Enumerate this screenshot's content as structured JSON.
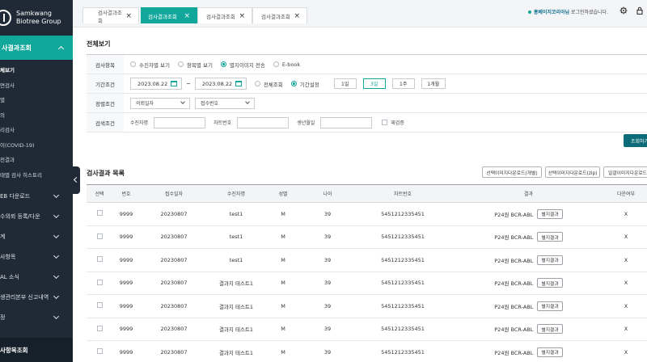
{
  "sidebar": {
    "logo_line1": "Samkwang",
    "logo_line2": "Biotree Group",
    "active_section": "사결과조회",
    "sub_items": [
      "체보기",
      "면검사",
      "별",
      "의",
      "리검사",
      "이(COVID-19)",
      "전결과",
      "태별 검사 히스토리"
    ],
    "menu_items": [
      "EB 다운로드",
      "수의뢰 등록/다운",
      "계",
      "사항목",
      "AL 소식",
      "생관리본부 신고내역",
      "정"
    ],
    "bottom": "사항목조회"
  },
  "tabs": [
    {
      "label": "검사결과조회",
      "active": false
    },
    {
      "label": "검사결과조회",
      "active": true
    },
    {
      "label": "검사결과조회",
      "active": false
    },
    {
      "label": "검사결과조회",
      "active": false
    }
  ],
  "topbar": {
    "user_bold": "홍베이지코리아님",
    "user_rest": "로그인하셨습니다."
  },
  "page": {
    "section_title": "전체보기",
    "filter": {
      "row1": {
        "label": "검사항목",
        "options": [
          "수진자별 보기",
          "항목별 보기",
          "별지이미지 전송",
          "E-book"
        ],
        "selected_index": 2
      },
      "row2": {
        "label": "기간조건",
        "date_from": "2023.08.22",
        "date_to": "2023.08.22",
        "options": [
          "전체조회",
          "기간설정"
        ],
        "selected_index": 1,
        "periods": [
          "1일",
          "3일",
          "1주",
          "1개월"
        ],
        "selected_period": 1
      },
      "row3": {
        "label": "정렬조건",
        "select1": "의뢰일자",
        "select2": "접수번호"
      },
      "row4": {
        "label": "검색조건",
        "field1": "수진자명",
        "field2": "차트번호",
        "field3": "생년월일",
        "checkbox": "재검증"
      }
    },
    "search_button": "조회하기",
    "list_title": "검사결과 목록",
    "download_buttons": [
      "선택이미지다운로드(개별)",
      "선택이미지다운로드(zip)",
      "일괄이미지다운로드"
    ]
  },
  "table": {
    "headers": [
      "선택",
      "번호",
      "접수일자",
      "수진자명",
      "성별",
      "나이",
      "차트번호",
      "결과",
      "다운여부"
    ],
    "rows": [
      {
        "no": "9999",
        "date": "20230807",
        "name": "test1",
        "sex": "M",
        "age": "39",
        "chart": "5451212335451",
        "result": "P24원 BCR-ABL",
        "btn": "별지결과",
        "dl": "X"
      },
      {
        "no": "9999",
        "date": "20230807",
        "name": "test1",
        "sex": "M",
        "age": "39",
        "chart": "5451212335451",
        "result": "P24원 BCR-ABL",
        "btn": "별지결과",
        "dl": "X"
      },
      {
        "no": "9999",
        "date": "20230807",
        "name": "test1",
        "sex": "M",
        "age": "39",
        "chart": "5451212335451",
        "result": "P24원 BCR-ABL",
        "btn": "별지결과",
        "dl": "X"
      },
      {
        "no": "9999",
        "date": "20230807",
        "name": "결과지 테스트1",
        "sex": "M",
        "age": "39",
        "chart": "5451212335451",
        "result": "P24원 BCR-ABL",
        "btn": "별지결과",
        "dl": "X"
      },
      {
        "no": "9999",
        "date": "20230807",
        "name": "결과지 테스트1",
        "sex": "M",
        "age": "39",
        "chart": "5451212335451",
        "result": "P24원 BCR-ABL",
        "btn": "별지결과",
        "dl": "X"
      },
      {
        "no": "9999",
        "date": "20230807",
        "name": "결과지 테스트1",
        "sex": "M",
        "age": "39",
        "chart": "5451212335451",
        "result": "P24원 BCR-ABL",
        "btn": "별지결과",
        "dl": "X"
      },
      {
        "no": "9999",
        "date": "20230807",
        "name": "결과지 테스트1",
        "sex": "M",
        "age": "39",
        "chart": "5451212335451",
        "result": "P24원 BCR-ABL",
        "btn": "별지결과",
        "dl": "X"
      }
    ]
  },
  "colors": {
    "accent": "#11a89b",
    "sidebar": "#1f2a36",
    "search_button": "#0c6b78"
  },
  "icons": [
    "chevron-up-icon",
    "chevron-down-icon",
    "close-icon",
    "calendar-icon",
    "gear-icon",
    "lock-icon"
  ]
}
